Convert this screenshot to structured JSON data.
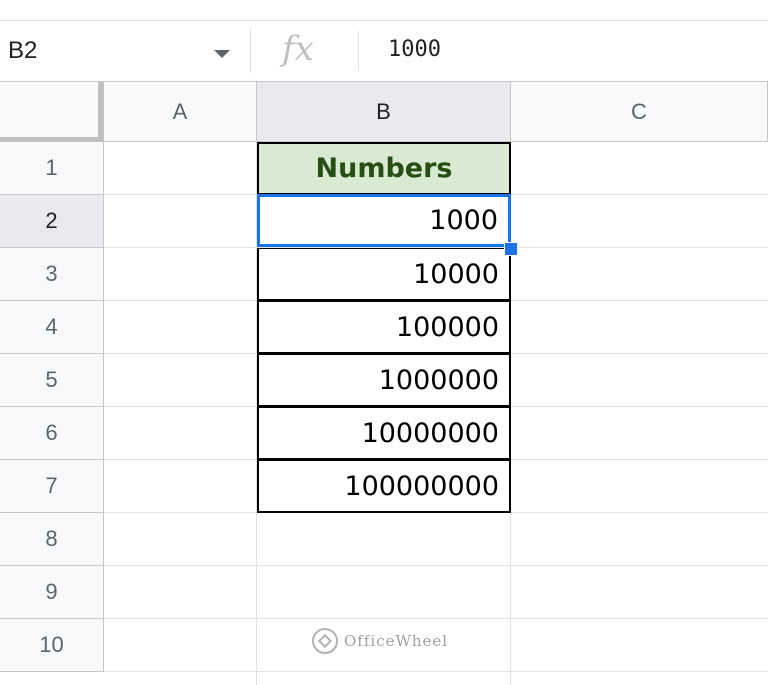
{
  "formula_bar": {
    "name_box": "B2",
    "fx_label": "fx",
    "value": "1000"
  },
  "columns": [
    "A",
    "B",
    "C"
  ],
  "rows": [
    "1",
    "2",
    "3",
    "4",
    "5",
    "6",
    "7",
    "8",
    "9",
    "10"
  ],
  "sheet": {
    "header_cell": "Numbers",
    "values": [
      "1000",
      "10000",
      "100000",
      "1000000",
      "10000000",
      "100000000"
    ]
  },
  "watermark": {
    "text": "OfficeWheel"
  },
  "colors": {
    "header_fill": "#d9ead3",
    "header_text": "#274e13",
    "selection": "#1a73e8"
  }
}
